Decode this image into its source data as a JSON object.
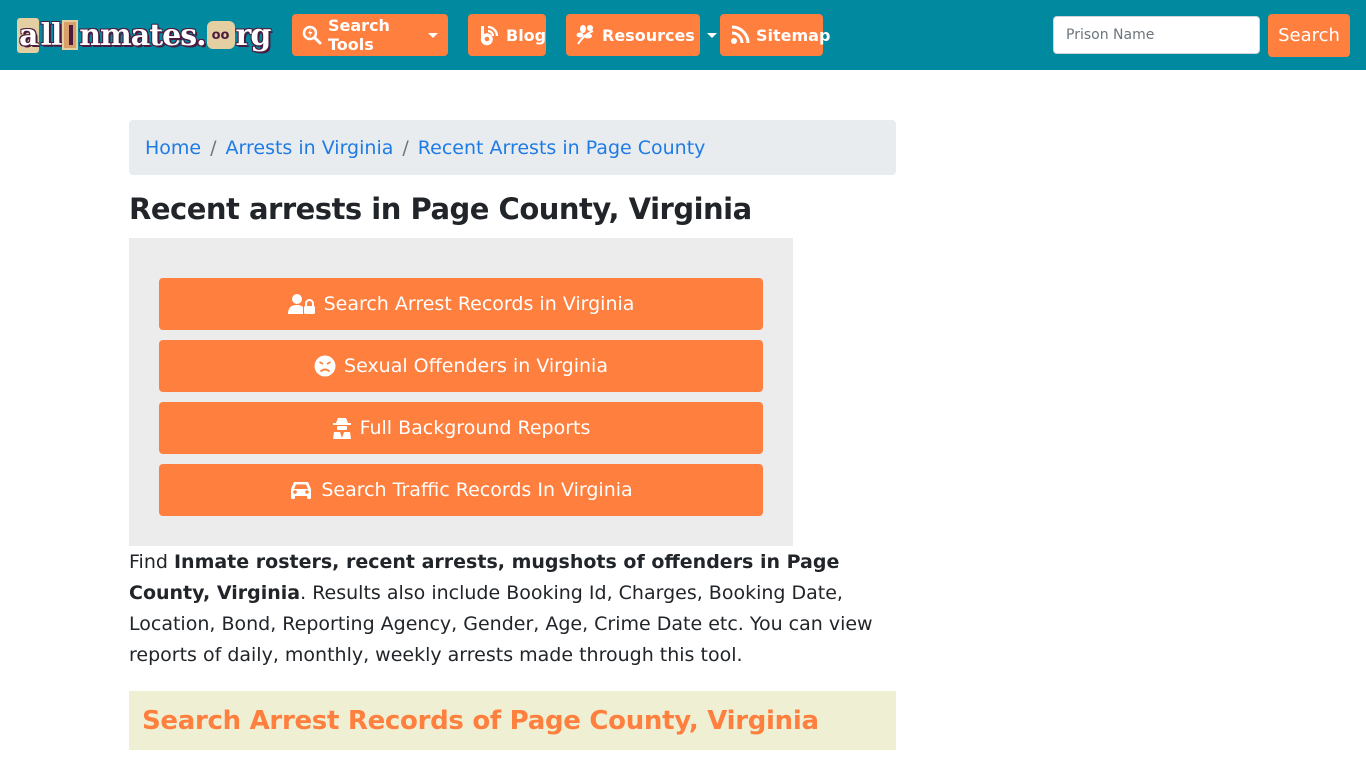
{
  "site": {
    "logo_text": {
      "part1": "a",
      "part2": "ll",
      "part3": "nmates.",
      "part4": "rg"
    },
    "logo_alt": "allinmates.org"
  },
  "nav": {
    "items": [
      {
        "label": "Search Tools",
        "icon": "search-bolt-icon",
        "has_dropdown": true
      },
      {
        "label": "Blog",
        "icon": "blogger-icon",
        "has_dropdown": false
      },
      {
        "label": "Resources",
        "icon": "leaf-icon",
        "has_dropdown": true
      },
      {
        "label": "Sitemap",
        "icon": "rss-icon",
        "has_dropdown": false
      }
    ],
    "search": {
      "placeholder": "Prison Name",
      "value": "",
      "button_label": "Search"
    }
  },
  "breadcrumb": [
    {
      "label": "Home"
    },
    {
      "label": "Arrests in Virginia"
    },
    {
      "label": "Recent Arrests in Page County"
    }
  ],
  "breadcrumb_separator": "/",
  "page": {
    "title": "Recent arrests in Page County, Virginia",
    "actions": [
      {
        "label": "Search Arrest Records in Virginia",
        "icon": "user-lock-icon"
      },
      {
        "label": "Sexual Offenders in Virginia",
        "icon": "angry-face-icon"
      },
      {
        "label": "Full Background Reports",
        "icon": "user-secret-icon"
      },
      {
        "label": "Search Traffic Records In Virginia",
        "icon": "car-icon"
      }
    ],
    "description": {
      "lead": "Find ",
      "bold": "Inmate rosters, recent arrests, mugshots of offenders in Page County, Virginia",
      "rest": ". Results also include Booking Id, Charges, Booking Date, Location, Bond, Reporting Agency, Gender, Age, Crime Date etc. You can view reports of daily, monthly, weekly arrests made through this tool."
    },
    "section_title": "Search Arrest Records of Page County, Virginia"
  },
  "colors": {
    "navbar": "#00899f",
    "accent": "#fe7f3e",
    "link": "#1e7be6",
    "breadcrumb_bg": "#e9ecef",
    "panel_bg": "#ececec",
    "section_bg": "#efefd4"
  }
}
